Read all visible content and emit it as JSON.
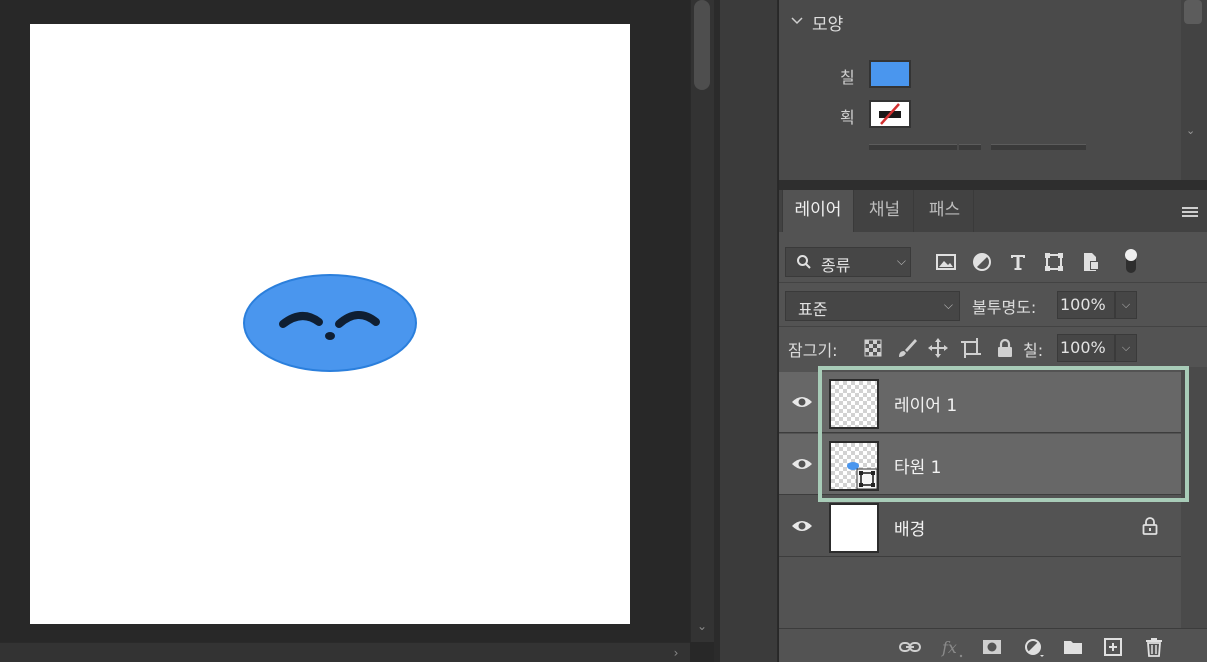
{
  "properties": {
    "section_title": "모양",
    "fill_label": "칠",
    "stroke_label": "획",
    "fill_color": "#4a96ee",
    "stroke_color": "none"
  },
  "layers_panel": {
    "tabs": [
      {
        "label": "레이어",
        "active": true
      },
      {
        "label": "채널",
        "active": false
      },
      {
        "label": "패스",
        "active": false
      }
    ],
    "filter_kind": "종류",
    "blend_mode": "표준",
    "opacity_label": "불투명도:",
    "opacity_value": "100%",
    "lock_label": "잠그기:",
    "fill_label": "칠:",
    "fill_value": "100%",
    "layers": [
      {
        "name": "레이어 1",
        "visible": true,
        "selected": true,
        "locked": false,
        "thumb": "transparent"
      },
      {
        "name": "타원 1",
        "visible": true,
        "selected": true,
        "locked": false,
        "thumb": "shape"
      },
      {
        "name": "배경",
        "visible": true,
        "selected": false,
        "locked": true,
        "thumb": "white"
      }
    ]
  },
  "canvas": {
    "background": "#ffffff",
    "ellipse_fill": "#4a96ee",
    "ellipse_stroke": "#2b7fdc",
    "feature_color": "#0f1f33"
  },
  "accent_highlight": "#a8ccb8"
}
